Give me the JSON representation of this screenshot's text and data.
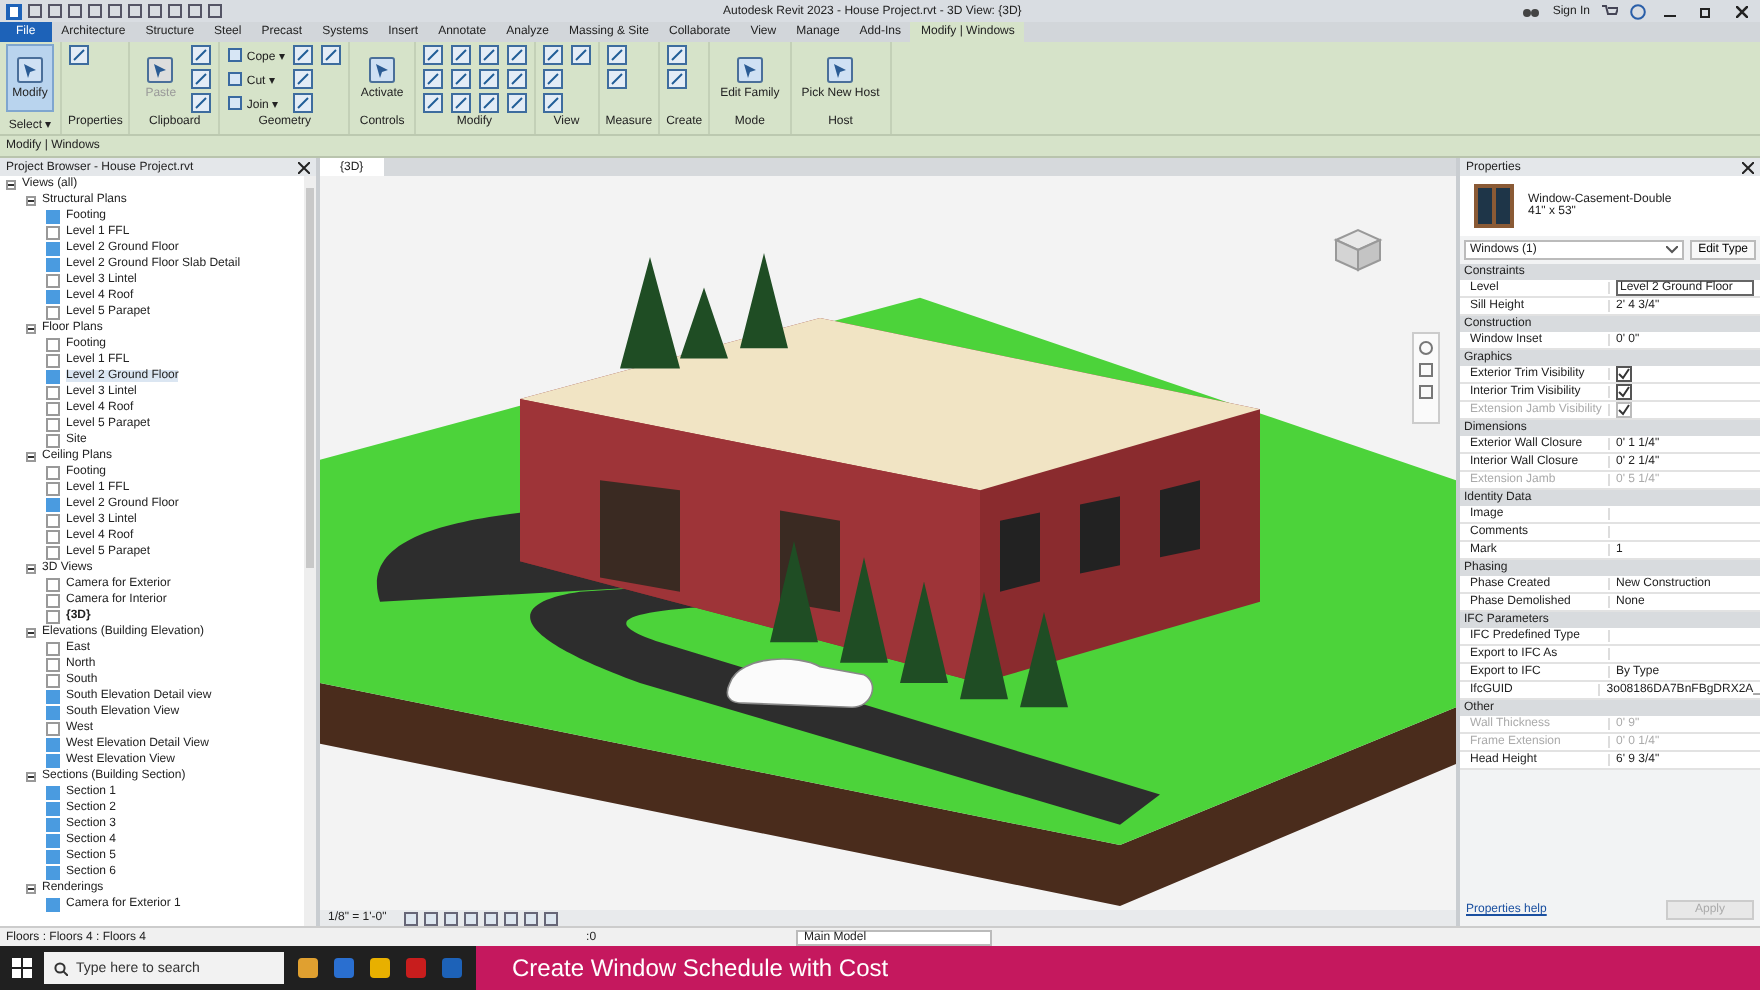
{
  "title_bar": {
    "title": "Autodesk Revit 2023 - House Project.rvt - 3D View: {3D}",
    "sign_in": "Sign In"
  },
  "ribbon": {
    "tabs": [
      {
        "label": "File",
        "kind": "file",
        "selected": false
      },
      {
        "label": "Architecture",
        "kind": "tab",
        "selected": false
      },
      {
        "label": "Structure",
        "kind": "tab",
        "selected": false
      },
      {
        "label": "Steel",
        "kind": "tab",
        "selected": false
      },
      {
        "label": "Precast",
        "kind": "tab",
        "selected": false
      },
      {
        "label": "Systems",
        "kind": "tab",
        "selected": false
      },
      {
        "label": "Insert",
        "kind": "tab",
        "selected": false
      },
      {
        "label": "Annotate",
        "kind": "tab",
        "selected": false
      },
      {
        "label": "Analyze",
        "kind": "tab",
        "selected": false
      },
      {
        "label": "Massing & Site",
        "kind": "tab",
        "selected": false
      },
      {
        "label": "Collaborate",
        "kind": "tab",
        "selected": false
      },
      {
        "label": "View",
        "kind": "tab",
        "selected": false
      },
      {
        "label": "Manage",
        "kind": "tab",
        "selected": false
      },
      {
        "label": "Add-Ins",
        "kind": "tab",
        "selected": false
      },
      {
        "label": "Modify | Windows",
        "kind": "tab",
        "selected": true
      }
    ],
    "panels": [
      {
        "title": "Select ▾",
        "tools": [
          {
            "kind": "large",
            "label": "Modify",
            "selected": true,
            "disabled": false
          }
        ]
      },
      {
        "title": "Properties",
        "tools": [
          {
            "kind": "icon"
          }
        ]
      },
      {
        "title": "Clipboard",
        "tools": [
          {
            "kind": "large",
            "label": "Paste",
            "selected": false,
            "disabled": true
          },
          {
            "kind": "icon"
          },
          {
            "kind": "icon"
          },
          {
            "kind": "icon"
          }
        ]
      },
      {
        "title": "Geometry",
        "tools": [
          {
            "kind": "small",
            "label": "Cope ▾"
          },
          {
            "kind": "small",
            "label": "Cut ▾"
          },
          {
            "kind": "small",
            "label": "Join ▾"
          },
          {
            "kind": "icon"
          },
          {
            "kind": "icon"
          },
          {
            "kind": "icon"
          },
          {
            "kind": "icon"
          }
        ]
      },
      {
        "title": "Controls",
        "tools": [
          {
            "kind": "large",
            "label": "Activate",
            "selected": false,
            "disabled": false
          }
        ]
      },
      {
        "title": "Modify",
        "tools": [
          {
            "kind": "icon"
          },
          {
            "kind": "icon"
          },
          {
            "kind": "icon"
          },
          {
            "kind": "icon"
          },
          {
            "kind": "icon"
          },
          {
            "kind": "icon"
          },
          {
            "kind": "icon"
          },
          {
            "kind": "icon"
          },
          {
            "kind": "icon"
          },
          {
            "kind": "icon"
          },
          {
            "kind": "icon"
          },
          {
            "kind": "icon"
          }
        ]
      },
      {
        "title": "View",
        "tools": [
          {
            "kind": "icon"
          },
          {
            "kind": "icon"
          },
          {
            "kind": "icon"
          },
          {
            "kind": "icon"
          }
        ]
      },
      {
        "title": "Measure",
        "tools": [
          {
            "kind": "icon"
          },
          {
            "kind": "icon"
          }
        ]
      },
      {
        "title": "Create",
        "tools": [
          {
            "kind": "icon"
          },
          {
            "kind": "icon"
          }
        ]
      },
      {
        "title": "Mode",
        "tools": [
          {
            "kind": "large",
            "label": "Edit Family",
            "selected": false,
            "disabled": false
          }
        ]
      },
      {
        "title": "Host",
        "tools": [
          {
            "kind": "large",
            "label": "Pick New Host",
            "selected": false,
            "disabled": false
          }
        ]
      }
    ],
    "context": "Modify | Windows"
  },
  "project_browser": {
    "title": "Project Browser - House Project.rvt",
    "tree": [
      {
        "kind": "category",
        "label": "Views (all)",
        "expanded": true,
        "children": [
          {
            "kind": "category",
            "label": "Structural Plans",
            "expanded": true,
            "children": [
              {
                "kind": "view",
                "label": "Footing",
                "marked": true,
                "selected": false,
                "current": false
              },
              {
                "kind": "view",
                "label": "Level 1 FFL",
                "marked": false,
                "selected": false,
                "current": false
              },
              {
                "kind": "view",
                "label": "Level 2 Ground Floor",
                "marked": true,
                "selected": false,
                "current": false
              },
              {
                "kind": "view",
                "label": "Level 2 Ground Floor Slab Detail",
                "marked": true,
                "selected": false,
                "current": false
              },
              {
                "kind": "view",
                "label": "Level 3 Lintel",
                "marked": false,
                "selected": false,
                "current": false
              },
              {
                "kind": "view",
                "label": "Level 4 Roof",
                "marked": true,
                "selected": false,
                "current": false
              },
              {
                "kind": "view",
                "label": "Level 5 Parapet",
                "marked": false,
                "selected": false,
                "current": false
              }
            ]
          },
          {
            "kind": "category",
            "label": "Floor Plans",
            "expanded": true,
            "children": [
              {
                "kind": "view",
                "label": "Footing",
                "marked": false,
                "selected": false,
                "current": false
              },
              {
                "kind": "view",
                "label": "Level 1 FFL",
                "marked": false,
                "selected": false,
                "current": false
              },
              {
                "kind": "view",
                "label": "Level 2 Ground Floor",
                "marked": true,
                "selected": true,
                "current": false
              },
              {
                "kind": "view",
                "label": "Level 3 Lintel",
                "marked": false,
                "selected": false,
                "current": false
              },
              {
                "kind": "view",
                "label": "Level 4 Roof",
                "marked": false,
                "selected": false,
                "current": false
              },
              {
                "kind": "view",
                "label": "Level 5 Parapet",
                "marked": false,
                "selected": false,
                "current": false
              },
              {
                "kind": "view",
                "label": "Site",
                "marked": false,
                "selected": false,
                "current": false
              }
            ]
          },
          {
            "kind": "category",
            "label": "Ceiling Plans",
            "expanded": true,
            "children": [
              {
                "kind": "view",
                "label": "Footing",
                "marked": false,
                "selected": false,
                "current": false
              },
              {
                "kind": "view",
                "label": "Level 1 FFL",
                "marked": false,
                "selected": false,
                "current": false
              },
              {
                "kind": "view",
                "label": "Level 2 Ground Floor",
                "marked": true,
                "selected": false,
                "current": false
              },
              {
                "kind": "view",
                "label": "Level 3 Lintel",
                "marked": false,
                "selected": false,
                "current": false
              },
              {
                "kind": "view",
                "label": "Level 4 Roof",
                "marked": false,
                "selected": false,
                "current": false
              },
              {
                "kind": "view",
                "label": "Level 5 Parapet",
                "marked": false,
                "selected": false,
                "current": false
              }
            ]
          },
          {
            "kind": "category",
            "label": "3D Views",
            "expanded": true,
            "children": [
              {
                "kind": "view",
                "label": "Camera for Exterior",
                "marked": false,
                "selected": false,
                "current": false
              },
              {
                "kind": "view",
                "label": "Camera for Interior",
                "marked": false,
                "selected": false,
                "current": false
              },
              {
                "kind": "view",
                "label": "{3D}",
                "marked": false,
                "selected": false,
                "current": true
              }
            ]
          },
          {
            "kind": "category",
            "label": "Elevations (Building Elevation)",
            "expanded": true,
            "children": [
              {
                "kind": "view",
                "label": "East",
                "marked": false,
                "selected": false,
                "current": false
              },
              {
                "kind": "view",
                "label": "North",
                "marked": false,
                "selected": false,
                "current": false
              },
              {
                "kind": "view",
                "label": "South",
                "marked": false,
                "selected": false,
                "current": false
              },
              {
                "kind": "view",
                "label": "South Elevation Detail view",
                "marked": true,
                "selected": false,
                "current": false
              },
              {
                "kind": "view",
                "label": "South Elevation View",
                "marked": true,
                "selected": false,
                "current": false
              },
              {
                "kind": "view",
                "label": "West",
                "marked": false,
                "selected": false,
                "current": false
              },
              {
                "kind": "view",
                "label": "West Elevation Detail View",
                "marked": true,
                "selected": false,
                "current": false
              },
              {
                "kind": "view",
                "label": "West Elevation View",
                "marked": true,
                "selected": false,
                "current": false
              }
            ]
          },
          {
            "kind": "category",
            "label": "Sections (Building Section)",
            "expanded": true,
            "children": [
              {
                "kind": "view",
                "label": "Section 1",
                "marked": true,
                "selected": false,
                "current": false
              },
              {
                "kind": "view",
                "label": "Section 2",
                "marked": true,
                "selected": false,
                "current": false
              },
              {
                "kind": "view",
                "label": "Section 3",
                "marked": true,
                "selected": false,
                "current": false
              },
              {
                "kind": "view",
                "label": "Section 4",
                "marked": true,
                "selected": false,
                "current": false
              },
              {
                "kind": "view",
                "label": "Section 5",
                "marked": true,
                "selected": false,
                "current": false
              },
              {
                "kind": "view",
                "label": "Section 6",
                "marked": true,
                "selected": false,
                "current": false
              }
            ]
          },
          {
            "kind": "category",
            "label": "Renderings",
            "expanded": true,
            "children": [
              {
                "kind": "view",
                "label": "Camera for Exterior 1",
                "marked": true,
                "selected": false,
                "current": false
              }
            ]
          }
        ]
      }
    ]
  },
  "view": {
    "tab": "{3D}",
    "scale": "1/8\" = 1'-0\""
  },
  "properties": {
    "title": "Properties",
    "type_name": "Window-Casement-Double",
    "type_size": "41\" x 53\"",
    "selector": "Windows (1)",
    "edit_type": "Edit Type",
    "groups": [
      {
        "name": "Constraints",
        "rows": [
          {
            "label": "Level",
            "value": "Level 2 Ground Floor",
            "kind": "field",
            "disabled": false
          },
          {
            "label": "Sill Height",
            "value": "2'  4 3/4\"",
            "kind": "text",
            "disabled": false
          }
        ]
      },
      {
        "name": "Construction",
        "rows": [
          {
            "label": "Window Inset",
            "value": "0'  0\"",
            "kind": "text",
            "disabled": false
          }
        ]
      },
      {
        "name": "Graphics",
        "rows": [
          {
            "label": "Exterior Trim Visibility",
            "kind": "check",
            "checked": true,
            "disabled": false
          },
          {
            "label": "Interior Trim Visibility",
            "kind": "check",
            "checked": true,
            "disabled": false
          },
          {
            "label": "Extension Jamb Visibility",
            "kind": "check",
            "checked": true,
            "disabled": true
          }
        ]
      },
      {
        "name": "Dimensions",
        "rows": [
          {
            "label": "Exterior Wall Closure",
            "value": "0'  1 1/4\"",
            "kind": "text",
            "disabled": false
          },
          {
            "label": "Interior Wall Closure",
            "value": "0'  2 1/4\"",
            "kind": "text",
            "disabled": false
          },
          {
            "label": "Extension Jamb",
            "value": "0'  5 1/4\"",
            "kind": "text",
            "disabled": true
          }
        ]
      },
      {
        "name": "Identity Data",
        "rows": [
          {
            "label": "Image",
            "value": "",
            "kind": "text",
            "disabled": false
          },
          {
            "label": "Comments",
            "value": "",
            "kind": "text",
            "disabled": false
          },
          {
            "label": "Mark",
            "value": "1",
            "kind": "text",
            "disabled": false
          }
        ]
      },
      {
        "name": "Phasing",
        "rows": [
          {
            "label": "Phase Created",
            "value": "New Construction",
            "kind": "text",
            "disabled": false
          },
          {
            "label": "Phase Demolished",
            "value": "None",
            "kind": "text",
            "disabled": false
          }
        ]
      },
      {
        "name": "IFC Parameters",
        "rows": [
          {
            "label": "IFC Predefined Type",
            "value": "",
            "kind": "text",
            "disabled": false
          },
          {
            "label": "Export to IFC As",
            "value": "",
            "kind": "text",
            "disabled": false
          },
          {
            "label": "Export to IFC",
            "value": "By Type",
            "kind": "text",
            "disabled": false
          },
          {
            "label": "IfcGUID",
            "value": "3o08186DA7BnFBgDRX2A_",
            "kind": "text",
            "disabled": false
          }
        ]
      },
      {
        "name": "Other",
        "rows": [
          {
            "label": "Wall Thickness",
            "value": "0'  9\"",
            "kind": "text",
            "disabled": true
          },
          {
            "label": "Frame Extension",
            "value": "0'  0 1/4\"",
            "kind": "text",
            "disabled": true
          },
          {
            "label": "Head Height",
            "value": "6'  9 3/4\"",
            "kind": "text",
            "disabled": false
          }
        ]
      }
    ],
    "help": "Properties help",
    "apply": {
      "label": "Apply",
      "disabled": true
    }
  },
  "status_bar": {
    "text": "Floors : Floors 4 : Floors 4",
    "sel_count": ":0",
    "model": "Main Model"
  },
  "taskbar": {
    "search": "Type here to search",
    "banner": "Create Window Schedule with Cost"
  }
}
